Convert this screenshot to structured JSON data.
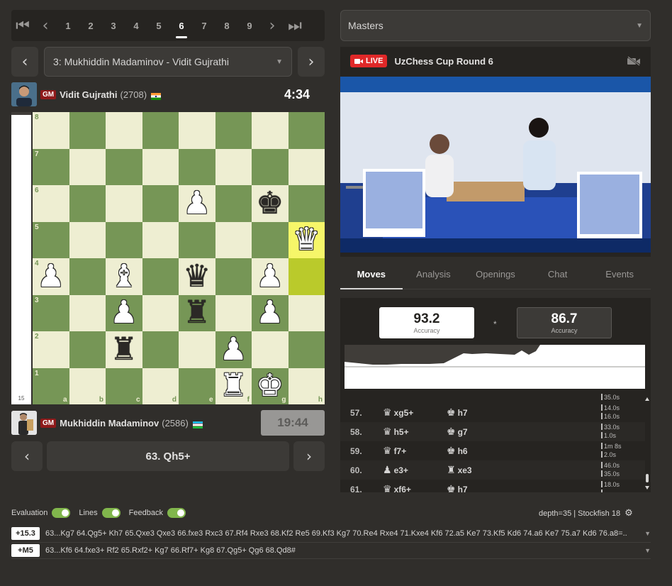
{
  "round_nav": {
    "first": "⏮",
    "prev": "‹",
    "rounds": [
      "1",
      "2",
      "3",
      "4",
      "5",
      "6",
      "7",
      "8",
      "9"
    ],
    "active": "6",
    "next": "›",
    "last": "⏭"
  },
  "game_select": {
    "prev": "‹",
    "value": "3: Mukhiddin Madaminov - Vidit Gujrathi",
    "next": "›"
  },
  "top_player": {
    "title": "GM",
    "name": "Vidit Gujrathi",
    "rating": "(2708)",
    "clock": "4:34"
  },
  "bottom_player": {
    "title": "GM",
    "name": "Mukhiddin Madaminov",
    "rating": "(2586)",
    "clock": "19:44"
  },
  "eval_bar": {
    "label": "15",
    "white_fraction": 0.99
  },
  "board": {
    "files": [
      "a",
      "b",
      "c",
      "d",
      "e",
      "f",
      "g",
      "h"
    ],
    "ranks": [
      "8",
      "7",
      "6",
      "5",
      "4",
      "3",
      "2",
      "1"
    ],
    "pieces": {
      "e6": "wP",
      "g6": "bK",
      "h5": "wQ",
      "a4": "wP",
      "c4": "wB",
      "e4": "bQ",
      "g4": "wP",
      "c3": "wP",
      "e3": "bR",
      "g3": "wP",
      "c2": "bR",
      "f2": "wP",
      "f1": "wR",
      "g1": "wK"
    },
    "highlight": [
      "h5",
      "h4"
    ]
  },
  "move_nav": {
    "prev": "‹",
    "current": "63. Qh5+",
    "next": "›"
  },
  "right": {
    "event_select": "Masters",
    "stream": {
      "live_label": "LIVE",
      "title": "UzChess Cup Round 6"
    },
    "tabs": [
      "Moves",
      "Analysis",
      "Openings",
      "Chat",
      "Events"
    ],
    "active_tab": "Moves",
    "accuracy": {
      "white": "93.2",
      "black": "86.7",
      "label": "Accuracy",
      "separator": "*"
    }
  },
  "moves": [
    {
      "num": "57.",
      "w_icon": "queen",
      "w": "xg5+",
      "b_icon": "king",
      "b": "h7",
      "t1": "14.0s",
      "t2": "16.0s"
    },
    {
      "num": "58.",
      "w_icon": "queen",
      "w": "h5+",
      "b_icon": "king",
      "b": "g7",
      "t1": "33.0s",
      "t2": "1.0s"
    },
    {
      "num": "59.",
      "w_icon": "queen",
      "w": "f7+",
      "b_icon": "king",
      "b": "h6",
      "t1": "1m 8s",
      "t2": "2.0s"
    },
    {
      "num": "60.",
      "w_icon": "pawn",
      "w": "e3+",
      "b_icon": "rook",
      "b": "xe3",
      "t1": "46.0s",
      "t2": "35.0s"
    },
    {
      "num": "61.",
      "w_icon": "queen",
      "w": "xf6+",
      "b_icon": "king",
      "b": "h7",
      "t1": "18.0s",
      "t2": ""
    }
  ],
  "moves_top_time": "35.0s",
  "engine": {
    "toggles": [
      {
        "label": "Evaluation"
      },
      {
        "label": "Lines"
      },
      {
        "label": "Feedback"
      }
    ],
    "depth": "depth=35 | Stockfish 18",
    "lines": [
      {
        "score": "+15.3",
        "pv": "63...Kg7 64.Qg5+ Kh7 65.Qxe3 Qxe3 66.fxe3 Rxc3 67.Rf4 Rxe3 68.Kf2 Re5 69.Kf3 Kg7 70.Re4 Rxe4 71.Kxe4 Kf6 72.a5 Ke7 73.Kf5 Kd6 74.a6 Ke7 75.a7 Kd6 76.a8=..."
      },
      {
        "score": "+M5",
        "pv": "63...Kf6 64.fxe3+ Rf2 65.Rxf2+ Kg7 66.Rf7+ Kg8 67.Qg5+ Qg6 68.Qd8#"
      }
    ]
  },
  "colors": {
    "light_square": "#eeeed2",
    "dark_square": "#769656",
    "highlight": "#f6f669",
    "toggle_on": "#81b64c",
    "live": "#e02828"
  }
}
